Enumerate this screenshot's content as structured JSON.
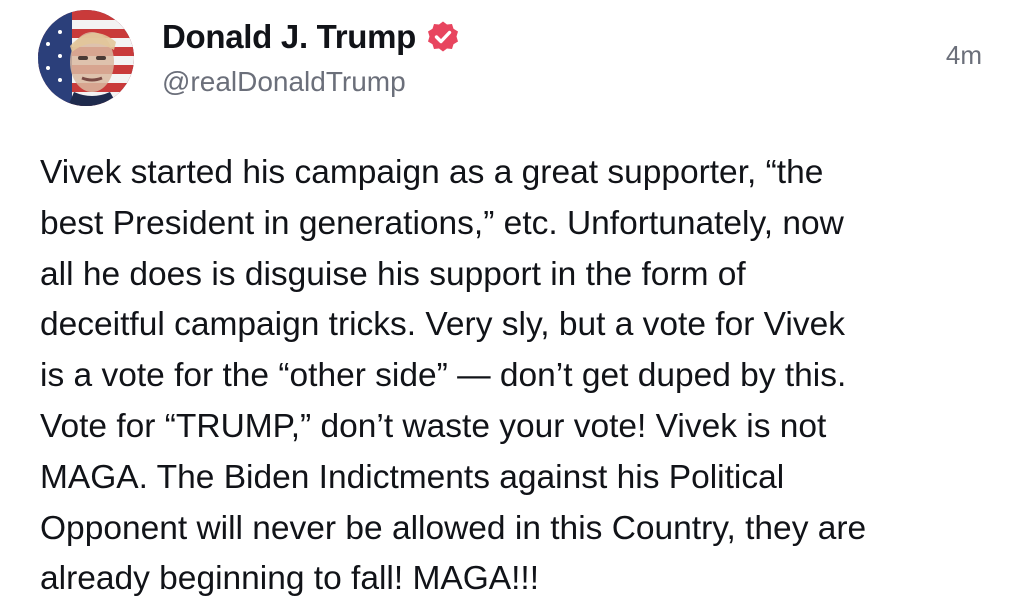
{
  "post": {
    "author_name": "Donald J. Trump",
    "author_handle": "@realDonaldTrump",
    "timestamp": "4m",
    "avatar_icon": "profile-photo-flag",
    "verified_icon": "verified-badge-icon",
    "verified_color": "#e8455f",
    "body_lines": [
      "Vivek started his campaign as a great supporter, “the",
      "best President in generations,” etc. Unfortunately, now",
      "all he does is disguise his support in the form of",
      "deceitful campaign tricks. Very sly, but a vote for Vivek",
      "is a vote for the “other side” — don’t get duped by this.",
      "Vote for “TRUMP,” don’t waste your vote! Vivek is not",
      "MAGA. The Biden Indictments against his Political",
      "Opponent will never be allowed in this Country, they are",
      "already beginning to fall! MAGA!!!"
    ]
  }
}
